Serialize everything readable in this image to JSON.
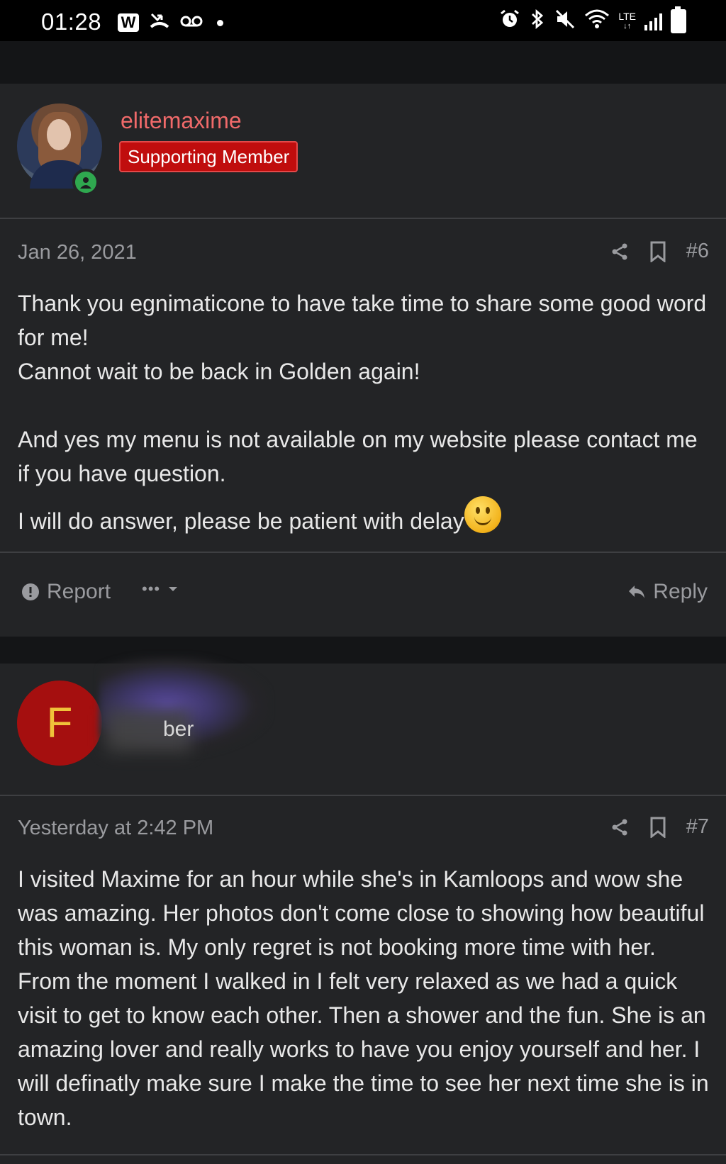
{
  "status_bar": {
    "time": "01:28",
    "app_badge": "W",
    "lte_label": "LTE",
    "icons": [
      "missed-call-icon",
      "voicemail-icon",
      "notification-dot-icon",
      "alarm-icon",
      "bluetooth-icon",
      "mute-icon",
      "wifi-icon",
      "lte-icon",
      "signal-icon",
      "battery-icon"
    ]
  },
  "post1": {
    "username": "elitemaxime",
    "badge": "Supporting Member",
    "date": "Jan 26, 2021",
    "number": "#6",
    "lines": [
      "Thank you egnimaticone to have take time to share some good word for me!",
      "Cannot wait to be back in Golden again!",
      "",
      "And yes my menu is not available on my website please contact me if you have question.",
      "I will do answer, please be patient with delay"
    ],
    "colors": {
      "username": "#f06a6a",
      "badge_bg": "#c00d0d",
      "online": "#2fa84f"
    }
  },
  "actions": {
    "report": "Report",
    "more": "•••",
    "reply": "Reply"
  },
  "post2": {
    "avatar_letter": "F",
    "role_fragment": "ber",
    "date": "Yesterday at 2:42 PM",
    "number": "#7",
    "body": "I visited Maxime for an hour while she's in Kamloops and wow she was amazing. Her photos don't come close to showing how beautiful this woman is. My only regret is not booking more time with her. From the moment I walked in I felt very relaxed as we had a quick visit to get to know each other. Then a shower and the fun. She is an amazing lover and really works to have you enjoy yourself and her. I will definatly make sure I make the time to see her next time she is in town."
  }
}
